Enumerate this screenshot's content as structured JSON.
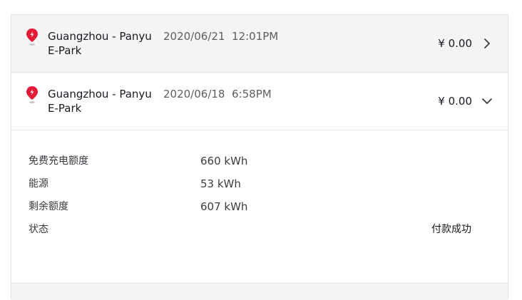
{
  "records": [
    {
      "location_line1": "Guangzhou - Panyu",
      "location_line2": "E-Park",
      "date": "2020/06/21",
      "time": "12:01PM",
      "amount": "¥ 0.00",
      "expanded": false,
      "chevron_icon": "chevron-right-icon"
    },
    {
      "location_line1": "Guangzhou - Panyu",
      "location_line2": "E-Park",
      "date": "2020/06/18",
      "time": "6:58PM",
      "amount": "¥ 0.00",
      "expanded": true,
      "chevron_icon": "chevron-down-icon"
    }
  ],
  "details": {
    "free_charge_label": "免费充电额度",
    "free_charge_value": "660 kWh",
    "energy_label": "能源",
    "energy_value": "53 kWh",
    "remaining_label": "剩余额度",
    "remaining_value": "607 kWh",
    "status_label": "状态",
    "status_value": "付款成功"
  },
  "colors": {
    "pin_red": "#e31937",
    "collapsed_bg": "#f4f4f4",
    "text_primary": "#171a20",
    "text_secondary": "#5c5e62"
  }
}
